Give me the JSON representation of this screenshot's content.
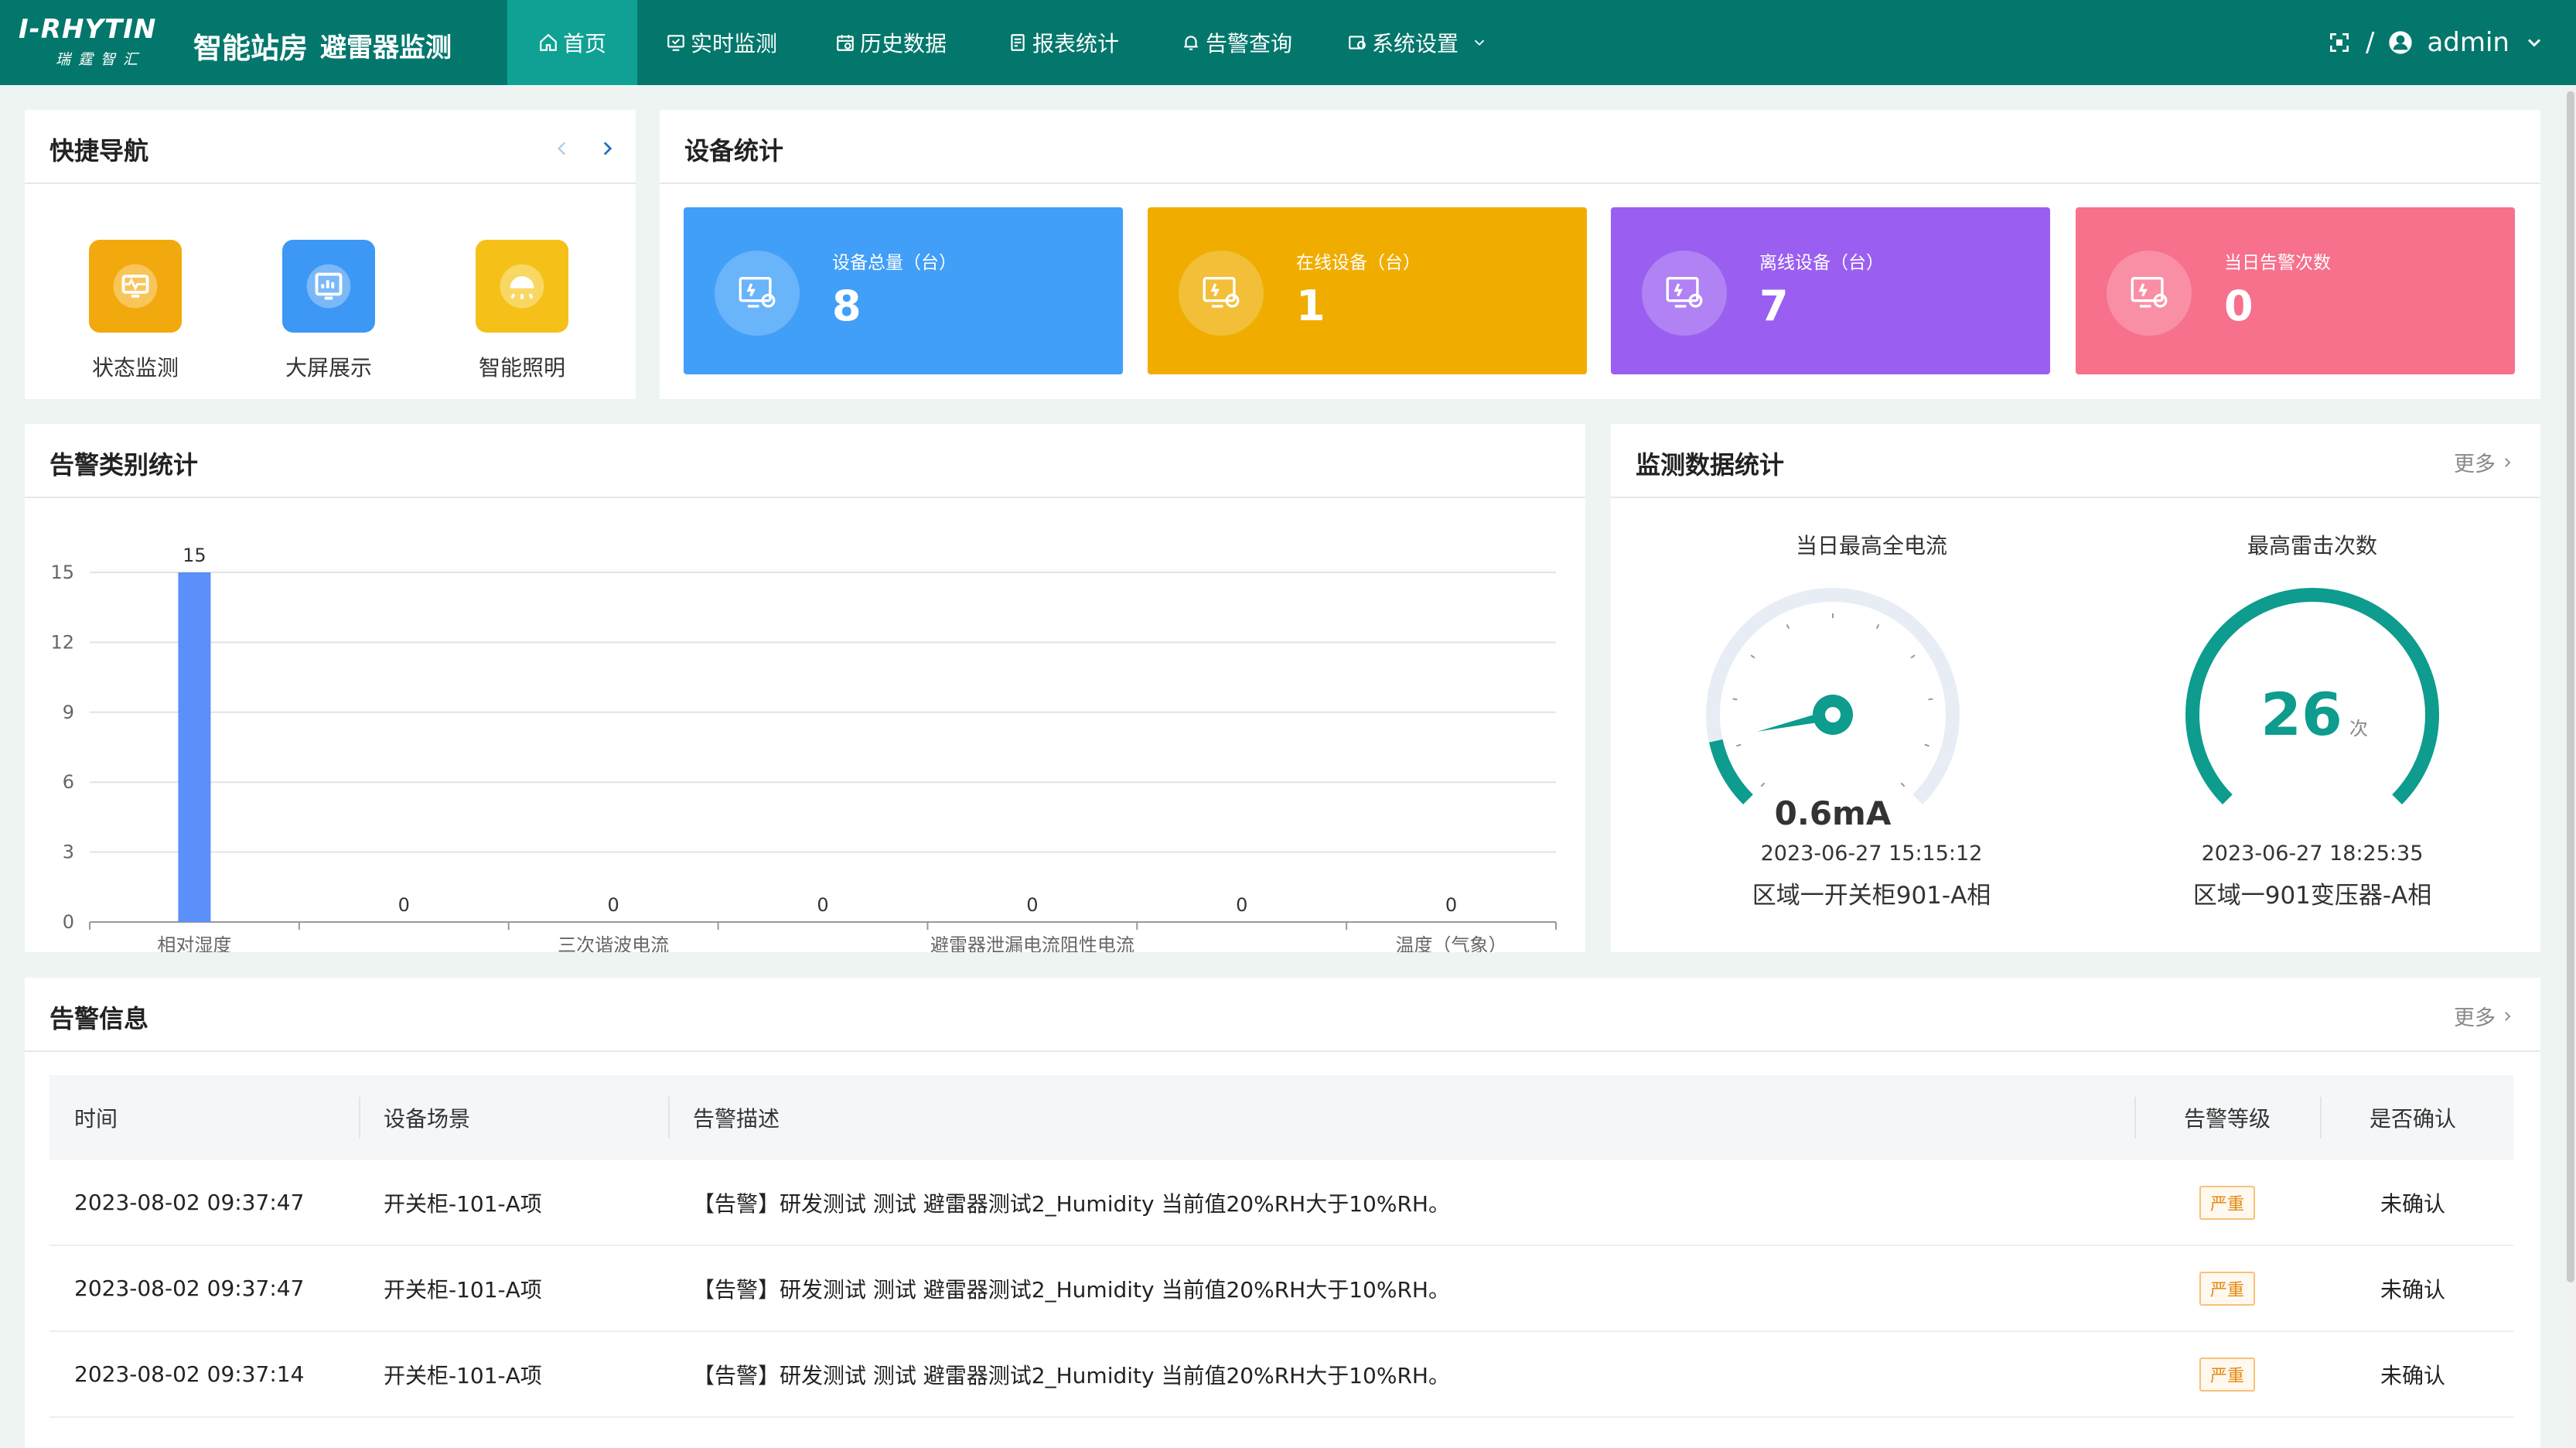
{
  "header": {
    "logo_main": "I-RHYTIN",
    "logo_sub": "瑞霆智汇",
    "app_title": "智能站房",
    "app_subtitle": "避雷器监测",
    "nav": [
      {
        "label": "首页",
        "icon": "home-icon",
        "active": true
      },
      {
        "label": "实时监测",
        "icon": "monitor-check-icon"
      },
      {
        "label": "历史数据",
        "icon": "calendar-icon"
      },
      {
        "label": "报表统计",
        "icon": "report-icon"
      },
      {
        "label": "告警查询",
        "icon": "bell-icon"
      },
      {
        "label": "系统设置",
        "icon": "settings-icon",
        "dropdown": true
      }
    ],
    "separator": "/",
    "user": "admin"
  },
  "quick_nav": {
    "title": "快捷导航",
    "items": [
      {
        "label": "状态监测",
        "icon": "monitor-pulse-icon",
        "color": "#f2a90d"
      },
      {
        "label": "大屏展示",
        "icon": "screen-chart-icon",
        "color": "#3d97f5"
      },
      {
        "label": "智能照明",
        "icon": "lamp-icon",
        "color": "#f5c018"
      }
    ]
  },
  "device_stats": {
    "title": "设备统计",
    "cards": [
      {
        "label": "设备总量（台）",
        "value": "8",
        "color": "#419ff8"
      },
      {
        "label": "在线设备（台）",
        "value": "1",
        "color": "#f0ad00"
      },
      {
        "label": "离线设备（台）",
        "value": "7",
        "color": "#9a5ff0"
      },
      {
        "label": "当日告警次数",
        "value": "0",
        "color": "#f7708c"
      }
    ]
  },
  "alarm_category": {
    "title": "告警类别统计",
    "chart_data": {
      "type": "bar",
      "categories": [
        "相对湿度",
        "",
        "三次谐波电流",
        "",
        "避雷器泄漏电流阻性电流",
        "",
        "温度（气象）"
      ],
      "values": [
        15,
        0,
        0,
        0,
        0,
        0,
        0
      ],
      "ylim": [
        0,
        15
      ],
      "yticks": [
        0,
        3,
        6,
        9,
        12,
        15
      ],
      "grid": true,
      "bar_color": "#5b8ff9"
    }
  },
  "monitoring": {
    "title": "监测数据统计",
    "more": "更多",
    "gauges": [
      {
        "title": "当日最高全电流",
        "value_text": "0.6mA",
        "value": 0.6,
        "max": 5,
        "time": "2023-06-27 15:15:12",
        "location": "区域一开关柜901-A相"
      },
      {
        "title": "最高雷击次数",
        "value_text": "26",
        "unit": "次",
        "value": 26,
        "time": "2023-06-27 18:25:35",
        "location": "区域一901变压器-A相"
      }
    ]
  },
  "alarm_info": {
    "title": "告警信息",
    "more": "更多",
    "columns": [
      "时间",
      "设备场景",
      "告警描述",
      "告警等级",
      "是否确认"
    ],
    "rows": [
      {
        "time": "2023-08-02 09:37:47",
        "scene": "开关柜-101-A项",
        "desc": "【告警】研发测试 测试 避雷器测试2_Humidity 当前值20%RH大于10%RH。",
        "level": "严重",
        "confirmed": "未确认"
      },
      {
        "time": "2023-08-02 09:37:47",
        "scene": "开关柜-101-A项",
        "desc": "【告警】研发测试 测试 避雷器测试2_Humidity 当前值20%RH大于10%RH。",
        "level": "严重",
        "confirmed": "未确认"
      },
      {
        "time": "2023-08-02 09:37:14",
        "scene": "开关柜-101-A项",
        "desc": "【告警】研发测试 测试 避雷器测试2_Humidity 当前值20%RH大于10%RH。",
        "level": "严重",
        "confirmed": "未确认"
      }
    ]
  }
}
